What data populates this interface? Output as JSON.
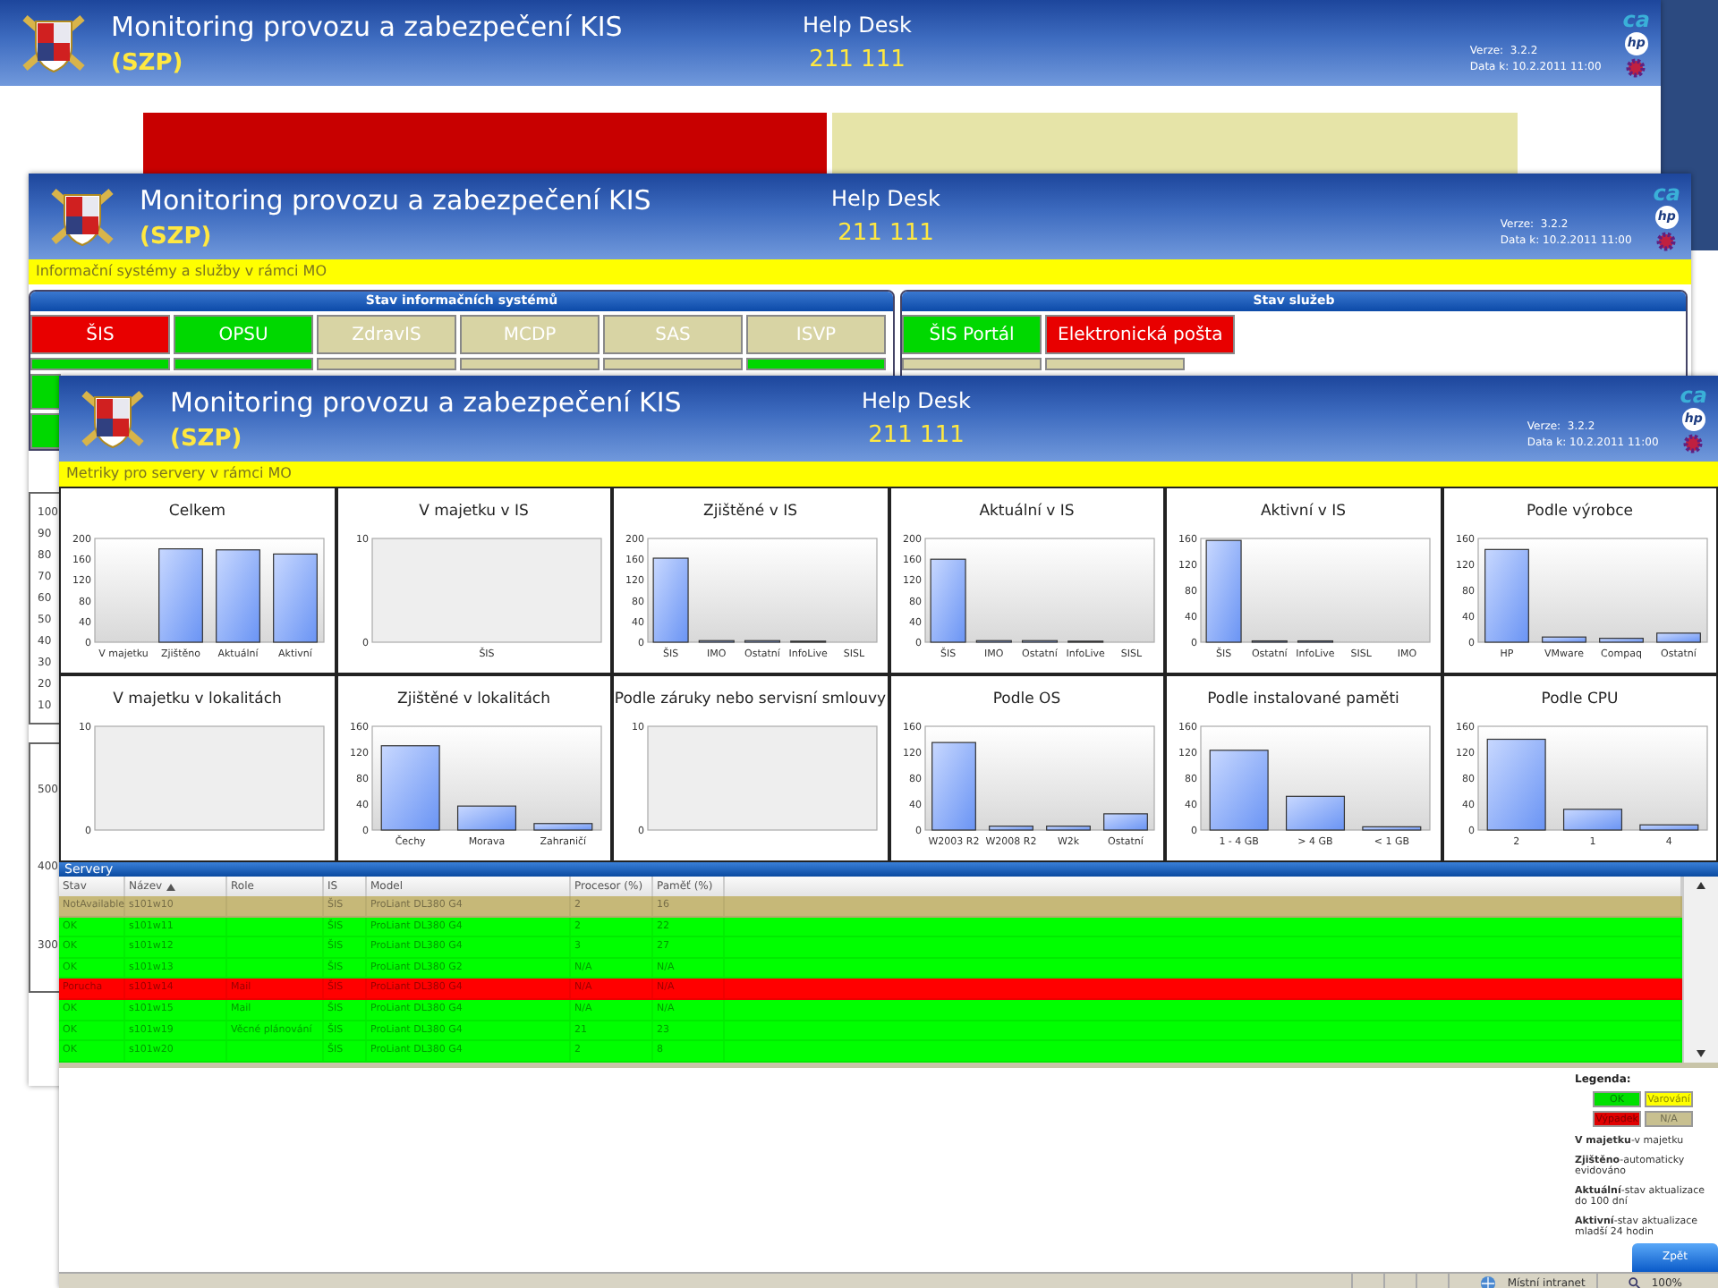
{
  "window_back": {
    "header": {
      "title": "Monitoring provozu a zabezpečení KIS",
      "subtitle": "(SZP)",
      "helpdesk_label": "Help Desk",
      "helpdesk_phone": "211 111",
      "version": "Verze:  3.2.2",
      "date": "Data k: 10.2.2011 11:00",
      "logos": [
        "ca",
        "hp"
      ]
    },
    "blocks": [
      {
        "color": "#c80000"
      },
      {
        "color": "#e6e4a8"
      }
    ]
  },
  "window_middle": {
    "header": {
      "title": "Monitoring provozu a zabezpečení KIS",
      "subtitle": "(SZP)",
      "helpdesk_label": "Help Desk",
      "helpdesk_phone": "211 111",
      "version": "Verze:  3.2.2",
      "date": "Data k: 10.2.2011 11:00",
      "logos": [
        "ca",
        "hp"
      ]
    },
    "info_bar": "Informační systémy a služby v rámci MO",
    "is_panel": {
      "title": "Stav informačních systémů",
      "tiles": [
        {
          "label": "ŠIS",
          "color": "#e80000"
        },
        {
          "label": "OPSU",
          "color": "#00d800"
        },
        {
          "label": "ZdravIS",
          "color": "#d8d4a4"
        },
        {
          "label": "MCDP",
          "color": "#d8d4a4"
        },
        {
          "label": "SAS",
          "color": "#d8d4a4"
        },
        {
          "label": "ISVP",
          "color": "#d8d4a4"
        }
      ],
      "hidden_rows": [
        [
          {
            "color": "#00d800"
          },
          {
            "color": "#00d800"
          },
          {
            "color": "#d8d4a4"
          },
          {
            "color": "#d8d4a4"
          },
          {
            "color": "#d8d4a4"
          },
          {
            "color": "#00d800"
          }
        ],
        [
          {
            "color": "#00d800"
          }
        ],
        [
          {
            "color": "#00d800"
          }
        ]
      ]
    },
    "services_panel": {
      "title": "Stav služeb",
      "tiles": [
        {
          "label": "ŠIS Portál",
          "color": "#00d800"
        },
        {
          "label": "Elektronická pošta",
          "color": "#e80000"
        }
      ],
      "hidden_rows": [
        [
          {
            "color": "#d8d4a4"
          },
          {
            "color": "#d8d4a4"
          }
        ]
      ]
    },
    "left_axis_1": [
      "100",
      "90",
      "80",
      "70",
      "60",
      "50",
      "40",
      "30",
      "20",
      "10"
    ],
    "left_axis_2": [
      "500",
      "400",
      "300"
    ]
  },
  "window_front": {
    "header": {
      "title": "Monitoring provozu a zabezpečení KIS",
      "subtitle": "(SZP)",
      "helpdesk_label": "Help Desk",
      "helpdesk_phone": "211 111",
      "version": "Verze:  3.2.2",
      "date": "Data k: 10.2.2011 11:00",
      "logos": [
        "ca",
        "hp"
      ]
    },
    "info_bar": "Metriky pro servery v rámci MO",
    "charts": [
      {
        "kind": "chart",
        "chart_data": {
          "type": "bar",
          "title": "Celkem",
          "categories": [
            "V majetku",
            "Zjištěno",
            "Aktuální",
            "Aktivní"
          ],
          "values": [
            0,
            180,
            178,
            170
          ],
          "ylim": [
            0,
            200
          ],
          "yticks": [
            0,
            40,
            80,
            120,
            160,
            200
          ]
        }
      },
      {
        "kind": "empty",
        "title": "V majetku v IS",
        "y_labels": [
          "10",
          "0"
        ],
        "x_labels": [
          "ŠIS"
        ]
      },
      {
        "kind": "chart",
        "chart_data": {
          "type": "bar",
          "title": "Zjištěné v IS",
          "categories": [
            "ŠIS",
            "IMO",
            "Ostatní",
            "InfoLive",
            "SISL"
          ],
          "values": [
            162,
            3,
            3,
            2,
            0
          ],
          "ylim": [
            0,
            200
          ],
          "yticks": [
            0,
            40,
            80,
            120,
            160,
            200
          ]
        }
      },
      {
        "kind": "chart",
        "chart_data": {
          "type": "bar",
          "title": "Aktuální v IS",
          "categories": [
            "ŠIS",
            "IMO",
            "Ostatní",
            "InfoLive",
            "SISL"
          ],
          "values": [
            160,
            3,
            3,
            2,
            0
          ],
          "ylim": [
            0,
            200
          ],
          "yticks": [
            0,
            40,
            80,
            120,
            160,
            200
          ]
        }
      },
      {
        "kind": "chart",
        "chart_data": {
          "type": "bar",
          "title": "Aktivní v IS",
          "categories": [
            "ŠIS",
            "Ostatní",
            "InfoLive",
            "SISL",
            "IMO"
          ],
          "values": [
            157,
            2,
            2,
            0,
            0
          ],
          "ylim": [
            0,
            160
          ],
          "yticks": [
            0,
            40,
            80,
            120,
            160
          ]
        }
      },
      {
        "kind": "chart",
        "chart_data": {
          "type": "bar",
          "title": "Podle výrobce",
          "categories": [
            "HP",
            "VMware",
            "Compaq",
            "Ostatní"
          ],
          "values": [
            143,
            8,
            6,
            14
          ],
          "ylim": [
            0,
            160
          ],
          "yticks": [
            0,
            40,
            80,
            120,
            160
          ]
        }
      },
      {
        "kind": "empty",
        "title": "V majetku v lokalitách",
        "y_labels": [
          "10",
          "0"
        ]
      },
      {
        "kind": "chart",
        "chart_data": {
          "type": "bar",
          "title": "Zjištěné v lokalitách",
          "categories": [
            "Čechy",
            "Morava",
            "Zahraničí"
          ],
          "values": [
            130,
            37,
            10
          ],
          "ylim": [
            0,
            160
          ],
          "yticks": [
            0,
            40,
            80,
            120,
            160
          ]
        }
      },
      {
        "kind": "empty",
        "title": "Podle záruky nebo servisní smlouvy",
        "y_labels": [
          "10",
          "0"
        ]
      },
      {
        "kind": "chart",
        "chart_data": {
          "type": "bar",
          "title": "Podle OS",
          "categories": [
            "W2003 R2",
            "W2008 R2",
            "W2k",
            "Ostatní"
          ],
          "values": [
            135,
            6,
            6,
            25
          ],
          "ylim": [
            0,
            160
          ],
          "yticks": [
            0,
            40,
            80,
            120,
            160
          ]
        }
      },
      {
        "kind": "chart",
        "chart_data": {
          "type": "bar",
          "title": "Podle instalované paměti",
          "categories": [
            "1 - 4 GB",
            "> 4 GB",
            "< 1 GB"
          ],
          "values": [
            123,
            52,
            5
          ],
          "ylim": [
            0,
            160
          ],
          "yticks": [
            0,
            40,
            80,
            120,
            160
          ]
        }
      },
      {
        "kind": "chart",
        "chart_data": {
          "type": "bar",
          "title": "Podle CPU",
          "categories": [
            "2",
            "1",
            "4"
          ],
          "values": [
            140,
            32,
            8
          ],
          "ylim": [
            0,
            160
          ],
          "yticks": [
            0,
            40,
            80,
            120,
            160
          ]
        }
      }
    ],
    "servers": {
      "title": "Servery",
      "columns": [
        {
          "label": "Stav",
          "sorted": false
        },
        {
          "label": "Název",
          "sorted": true
        },
        {
          "label": "Role",
          "sorted": false
        },
        {
          "label": "IS",
          "sorted": false
        },
        {
          "label": "Model",
          "sorted": false
        },
        {
          "label": "Procesor (%)",
          "sorted": false
        },
        {
          "label": "Paměť (%)",
          "sorted": false
        }
      ],
      "rows": [
        {
          "color": "#c6b878",
          "cells": [
            "NotAvailable",
            "s101w10",
            "",
            "ŠIS",
            "ProLiant DL380 G4",
            "2",
            "16"
          ]
        },
        {
          "color": "#00ff00",
          "cells": [
            "OK",
            "s101w11",
            "",
            "ŠIS",
            "ProLiant DL380 G4",
            "2",
            "22"
          ]
        },
        {
          "color": "#00ff00",
          "cells": [
            "OK",
            "s101w12",
            "",
            "ŠIS",
            "ProLiant DL380 G4",
            "3",
            "27"
          ]
        },
        {
          "color": "#00ff00",
          "cells": [
            "OK",
            "s101w13",
            "",
            "ŠIS",
            "ProLiant DL380 G2",
            "N/A",
            "N/A"
          ]
        },
        {
          "color": "#ff0000",
          "cells": [
            "Porucha",
            "s101w14",
            "Mail",
            "ŠIS",
            "ProLiant DL380 G4",
            "N/A",
            "N/A"
          ]
        },
        {
          "color": "#00ff00",
          "cells": [
            "OK",
            "s101w15",
            "Mail",
            "ŠIS",
            "ProLiant DL380 G4",
            "N/A",
            "N/A"
          ]
        },
        {
          "color": "#00ff00",
          "cells": [
            "OK",
            "s101w19",
            "Věcné plánování",
            "ŠIS",
            "ProLiant DL380 G4",
            "21",
            "23"
          ]
        },
        {
          "color": "#00ff00",
          "cells": [
            "OK",
            "s101w20",
            "",
            "ŠIS",
            "ProLiant DL380 G4",
            "2",
            "8"
          ]
        }
      ]
    },
    "legend": {
      "title": "Legenda:",
      "items": [
        {
          "label": "OK",
          "color": "#00e000"
        },
        {
          "label": "Varování",
          "color": "#ffff00"
        },
        {
          "label": "Výpadek",
          "color": "#e00000"
        },
        {
          "label": "N/A",
          "color": "#c8c090"
        }
      ],
      "notes": [
        "**V majetku**-v majetku",
        "**Zjištěno**-automaticky evidováno",
        "**Aktuální**-stav aktualizace do 100 dní",
        "**Aktivní**-stav aktualizace mladší 24 hodin"
      ]
    },
    "back_button": "Zpět",
    "status_bar": {
      "zone": "Místní intranet",
      "zoom": "100%"
    }
  }
}
